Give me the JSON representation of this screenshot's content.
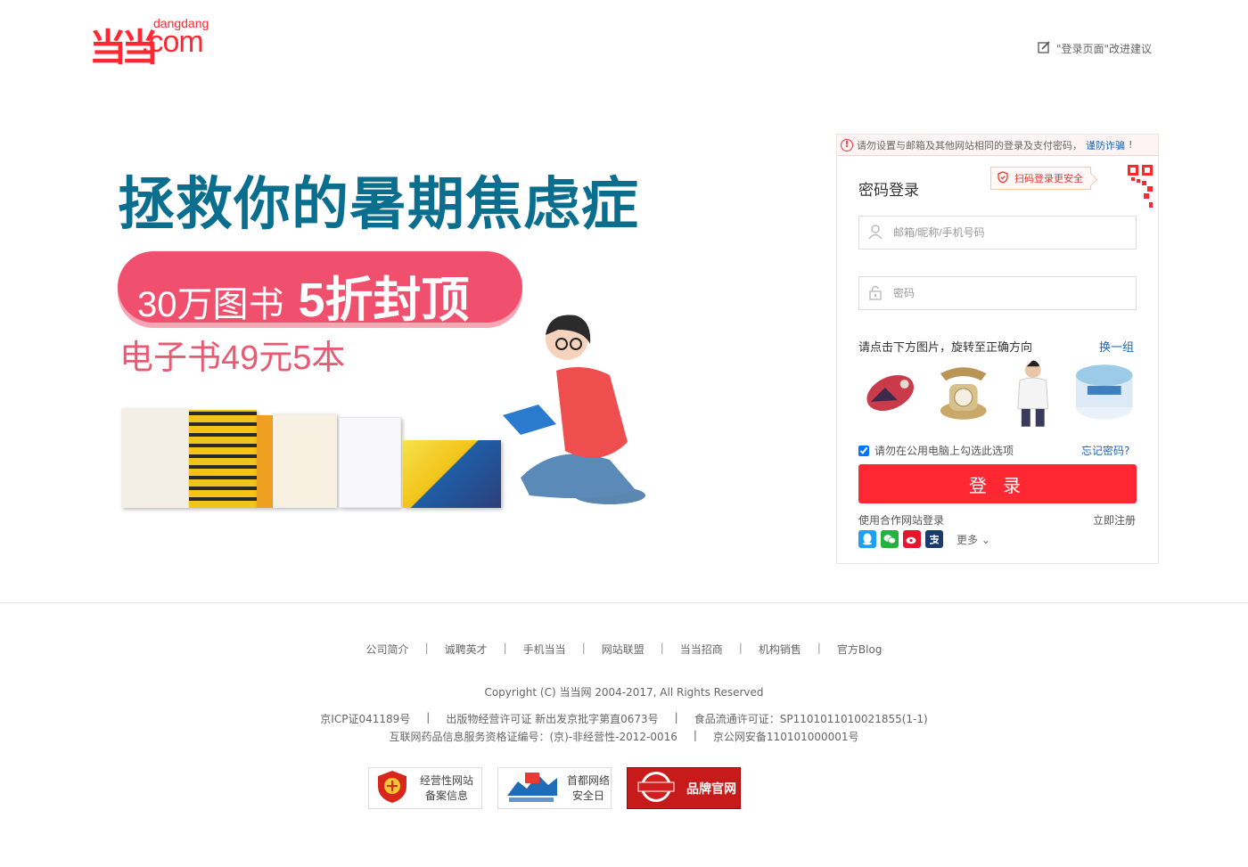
{
  "header": {
    "logo_mark": "当当",
    "logo_small": "dangdang",
    "logo_com": ".com",
    "feedback_text": "\"登录页面\"改进建议"
  },
  "banner": {
    "headline": "拯救你的暑期焦虑症",
    "pill_text": "30万图书",
    "pill_big": "5折封顶",
    "sub": "电子书49元5本"
  },
  "login": {
    "warning": "请勿设置与邮箱及其他网站相同的登录及支付密码，",
    "warning_link": "谨防诈骗",
    "warning_end": "!",
    "title": "密码登录",
    "qr_tip": "扫码登录更安全",
    "username_placeholder": "邮箱/昵称/手机号码",
    "password_placeholder": "密码",
    "captcha_label": "请点击下方图片，旋转至正确方向",
    "captcha_refresh": "换一组",
    "remember_label": "请勿在公用电脑上勾选此选项",
    "forgot": "忘记密码?",
    "login_button": "登 录",
    "partner_label": "使用合作网站登录",
    "register": "立即注册",
    "more": "更多",
    "socials": [
      "qq-icon",
      "wechat-icon",
      "weibo-icon",
      "alipay-icon"
    ]
  },
  "footer": {
    "links": [
      "公司简介",
      "诚聘英才",
      "手机当当",
      "网站联盟",
      "当当招商",
      "机构销售",
      "官方Blog"
    ],
    "copyright": "Copyright (C) 当当网 2004-2017, All Rights Reserved",
    "license_row1": [
      "京ICP证041189号",
      "出版物经营许可证 新出发京批字第直0673号",
      "食品流通许可证：SP1101011010021855(1-1)"
    ],
    "license_row2": [
      "互联网药品信息服务资格证编号：(京)-非经营性-2012-0016",
      "京公网安备110101000001号"
    ],
    "badge1_line1": "经营性网站",
    "badge1_line2": "备案信息",
    "badge2_line1": "首都网络",
    "badge2_line2": "安全日",
    "badge3_brand": "品牌官网"
  },
  "colors": {
    "brand_red": "#ff2832",
    "link_blue": "#1a66b3",
    "headline_teal": "#0a6f8e",
    "pill_pink": "#f0506e"
  }
}
